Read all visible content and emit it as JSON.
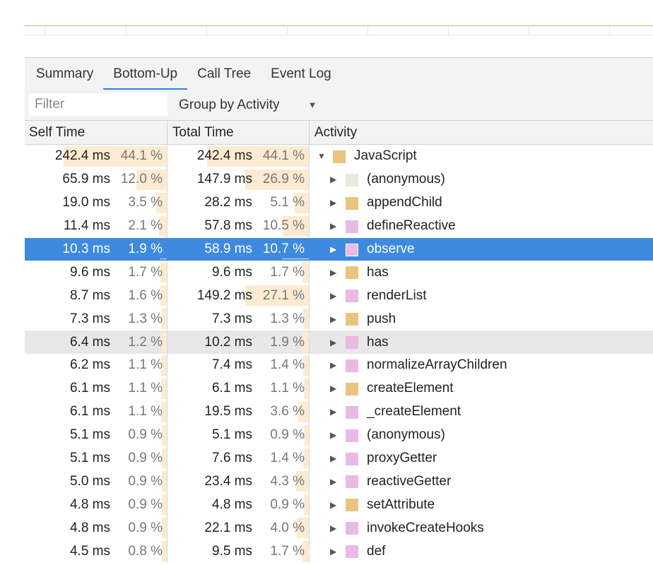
{
  "colors": {
    "scripting": "#e9c480",
    "rendering": "#eab9e6",
    "other": "#ece9dc",
    "selected_row": "#3d8ae0",
    "tab_accent": "#3879d9",
    "bar_fill": "#fcebd0"
  },
  "tabs": [
    {
      "label": "Summary",
      "active": false
    },
    {
      "label": "Bottom-Up",
      "active": true
    },
    {
      "label": "Call Tree",
      "active": false
    },
    {
      "label": "Event Log",
      "active": false
    }
  ],
  "filter": {
    "placeholder": "Filter",
    "value": ""
  },
  "group_by": {
    "label": "Group by Activity",
    "caret_icon": "triangle-down-icon"
  },
  "columns": {
    "self_time": "Self Time",
    "total_time": "Total Time",
    "activity": "Activity"
  },
  "rows": [
    {
      "self_ms": "242.4 ms",
      "self_pct": "44.1 %",
      "self_frac": 0.441,
      "total_ms": "242.4 ms",
      "total_pct": "44.1 %",
      "total_frac": 0.441,
      "name": "JavaScript",
      "category": "scripting",
      "depth": 0,
      "expanded": true,
      "selected": false,
      "alt": false
    },
    {
      "self_ms": "65.9 ms",
      "self_pct": "12.0 %",
      "self_frac": 0.12,
      "total_ms": "147.9 ms",
      "total_pct": "26.9 %",
      "total_frac": 0.269,
      "name": "(anonymous)",
      "category": "other",
      "depth": 1,
      "expanded": false,
      "selected": false,
      "alt": false
    },
    {
      "self_ms": "19.0 ms",
      "self_pct": "3.5 %",
      "self_frac": 0.035,
      "total_ms": "28.2 ms",
      "total_pct": "5.1 %",
      "total_frac": 0.051,
      "name": "appendChild",
      "category": "scripting",
      "depth": 1,
      "expanded": false,
      "selected": false,
      "alt": false
    },
    {
      "self_ms": "11.4 ms",
      "self_pct": "2.1 %",
      "self_frac": 0.021,
      "total_ms": "57.8 ms",
      "total_pct": "10.5 %",
      "total_frac": 0.105,
      "name": "defineReactive",
      "category": "rendering",
      "depth": 1,
      "expanded": false,
      "selected": false,
      "alt": false
    },
    {
      "self_ms": "10.3 ms",
      "self_pct": "1.9 %",
      "self_frac": 0.019,
      "total_ms": "58.9 ms",
      "total_pct": "10.7 %",
      "total_frac": 0.107,
      "name": "observe",
      "category": "rendering",
      "depth": 1,
      "expanded": false,
      "selected": true,
      "alt": false
    },
    {
      "self_ms": "9.6 ms",
      "self_pct": "1.7 %",
      "self_frac": 0.017,
      "total_ms": "9.6 ms",
      "total_pct": "1.7 %",
      "total_frac": 0.017,
      "name": "has",
      "category": "scripting",
      "depth": 1,
      "expanded": false,
      "selected": false,
      "alt": false
    },
    {
      "self_ms": "8.7 ms",
      "self_pct": "1.6 %",
      "self_frac": 0.016,
      "total_ms": "149.2 ms",
      "total_pct": "27.1 %",
      "total_frac": 0.271,
      "name": "renderList",
      "category": "rendering",
      "depth": 1,
      "expanded": false,
      "selected": false,
      "alt": false
    },
    {
      "self_ms": "7.3 ms",
      "self_pct": "1.3 %",
      "self_frac": 0.013,
      "total_ms": "7.3 ms",
      "total_pct": "1.3 %",
      "total_frac": 0.013,
      "name": "push",
      "category": "scripting",
      "depth": 1,
      "expanded": false,
      "selected": false,
      "alt": false
    },
    {
      "self_ms": "6.4 ms",
      "self_pct": "1.2 %",
      "self_frac": 0.012,
      "total_ms": "10.2 ms",
      "total_pct": "1.9 %",
      "total_frac": 0.019,
      "name": "has",
      "category": "rendering",
      "depth": 1,
      "expanded": false,
      "selected": false,
      "alt": true
    },
    {
      "self_ms": "6.2 ms",
      "self_pct": "1.1 %",
      "self_frac": 0.011,
      "total_ms": "7.4 ms",
      "total_pct": "1.4 %",
      "total_frac": 0.014,
      "name": "normalizeArrayChildren",
      "category": "rendering",
      "depth": 1,
      "expanded": false,
      "selected": false,
      "alt": false
    },
    {
      "self_ms": "6.1 ms",
      "self_pct": "1.1 %",
      "self_frac": 0.011,
      "total_ms": "6.1 ms",
      "total_pct": "1.1 %",
      "total_frac": 0.011,
      "name": "createElement",
      "category": "scripting",
      "depth": 1,
      "expanded": false,
      "selected": false,
      "alt": false
    },
    {
      "self_ms": "6.1 ms",
      "self_pct": "1.1 %",
      "self_frac": 0.011,
      "total_ms": "19.5 ms",
      "total_pct": "3.6 %",
      "total_frac": 0.036,
      "name": "_createElement",
      "category": "rendering",
      "depth": 1,
      "expanded": false,
      "selected": false,
      "alt": false
    },
    {
      "self_ms": "5.1 ms",
      "self_pct": "0.9 %",
      "self_frac": 0.009,
      "total_ms": "5.1 ms",
      "total_pct": "0.9 %",
      "total_frac": 0.009,
      "name": "(anonymous)",
      "category": "rendering",
      "depth": 1,
      "expanded": false,
      "selected": false,
      "alt": false
    },
    {
      "self_ms": "5.1 ms",
      "self_pct": "0.9 %",
      "self_frac": 0.009,
      "total_ms": "7.6 ms",
      "total_pct": "1.4 %",
      "total_frac": 0.014,
      "name": "proxyGetter",
      "category": "rendering",
      "depth": 1,
      "expanded": false,
      "selected": false,
      "alt": false
    },
    {
      "self_ms": "5.0 ms",
      "self_pct": "0.9 %",
      "self_frac": 0.009,
      "total_ms": "23.4 ms",
      "total_pct": "4.3 %",
      "total_frac": 0.043,
      "name": "reactiveGetter",
      "category": "rendering",
      "depth": 1,
      "expanded": false,
      "selected": false,
      "alt": false
    },
    {
      "self_ms": "4.8 ms",
      "self_pct": "0.9 %",
      "self_frac": 0.009,
      "total_ms": "4.8 ms",
      "total_pct": "0.9 %",
      "total_frac": 0.009,
      "name": "setAttribute",
      "category": "scripting",
      "depth": 1,
      "expanded": false,
      "selected": false,
      "alt": false
    },
    {
      "self_ms": "4.8 ms",
      "self_pct": "0.9 %",
      "self_frac": 0.009,
      "total_ms": "22.1 ms",
      "total_pct": "4.0 %",
      "total_frac": 0.04,
      "name": "invokeCreateHooks",
      "category": "rendering",
      "depth": 1,
      "expanded": false,
      "selected": false,
      "alt": false
    },
    {
      "self_ms": "4.5 ms",
      "self_pct": "0.8 %",
      "self_frac": 0.008,
      "total_ms": "9.5 ms",
      "total_pct": "1.7 %",
      "total_frac": 0.017,
      "name": "def",
      "category": "rendering",
      "depth": 1,
      "expanded": false,
      "selected": false,
      "alt": false
    }
  ]
}
